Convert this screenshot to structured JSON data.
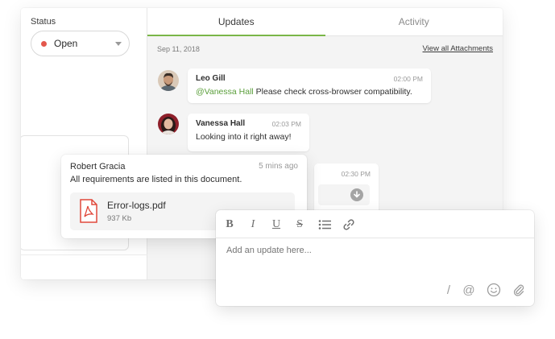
{
  "status": {
    "label": "Status",
    "value": "Open",
    "dot_color": "#e3574c"
  },
  "tabs": [
    {
      "label": "Updates",
      "active": true
    },
    {
      "label": "Activity",
      "active": false
    }
  ],
  "accent_color": "#7ab648",
  "feed": {
    "date": "Sep 11, 2018",
    "view_all": "View all Attachments",
    "messages": [
      {
        "name": "Leo Gill",
        "time": "02:00 PM",
        "mention": "@Vanessa Hall",
        "text": " Please check cross-browser compatibility."
      },
      {
        "name": "Vanessa Hall",
        "time": "02:03 PM",
        "text": "Looking into it right away!"
      }
    ],
    "partial_time": "02:30 PM"
  },
  "attachment_card": {
    "name": "Robert Gracia",
    "time": "5 mins ago",
    "text": "All requirements are listed in this document.",
    "file": {
      "name": "Error-logs.pdf",
      "size": "937 Kb",
      "icon": "pdf-icon"
    }
  },
  "editor": {
    "toolbar": {
      "bold": "B",
      "italic": "I",
      "underline": "U",
      "strike": "S"
    },
    "placeholder": "Add an update here...",
    "actions": {
      "slash": "/",
      "mention": "@"
    }
  }
}
